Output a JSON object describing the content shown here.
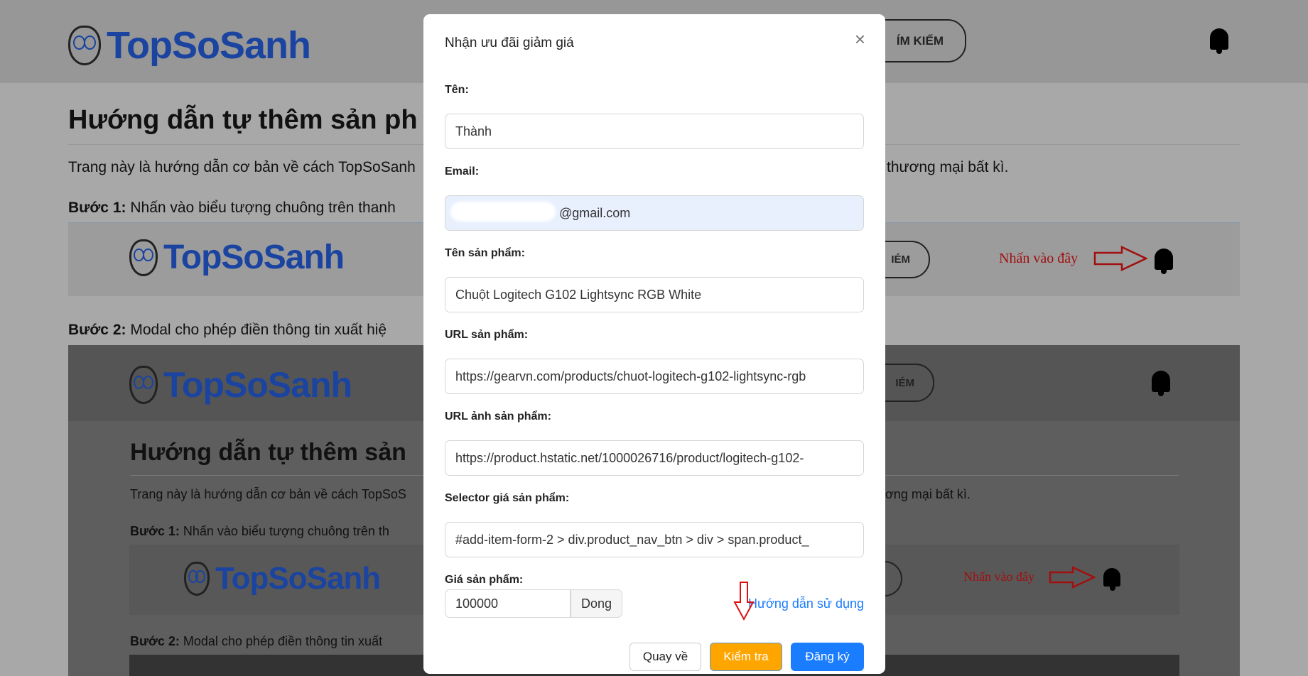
{
  "brand": {
    "name": "TopSoSanh",
    "search_label": "TÌM KIẾM",
    "search_label_partial": "ÍM KIẾM",
    "search_label_short": "IÉM"
  },
  "page": {
    "title": "Hướng dẫn tự thêm sản phẩm",
    "title_visible": "Hướng dẫn tự thêm sản ph",
    "intro_left": "Trang này là hướng dẫn cơ bản về cách TopSoSanh",
    "intro_right": "thương mại bất kì.",
    "step1_label": "Bước 1:",
    "step1_text": "Nhấn vào biểu tượng chuông trên thanh",
    "step2_label": "Bước 2:",
    "step2_text": "Modal cho phép điền thông tin xuất hiệ",
    "click_here": "Nhấn vào đây",
    "inner": {
      "title": "Hướng dẫn tự thêm sản",
      "intro_left": "Trang này là hướng dẫn cơ bản về cách TopSoS",
      "intro_right": "ơng mại bất kì.",
      "step1_text": "Nhấn vào biểu tượng chuông trên th",
      "step2_text": "Modal cho phép điền thông tin xuất"
    }
  },
  "modal": {
    "title": "Nhận ưu đãi giảm giá",
    "close": "×",
    "fields": [
      {
        "label": "Tên:",
        "value": "Thành"
      },
      {
        "label": "Email:",
        "value": "@gmail.com"
      },
      {
        "label": "Tên sản phẩm:",
        "value": "Chuột Logitech G102 Lightsync RGB White"
      },
      {
        "label": "URL sản phẩm:",
        "value": "https://gearvn.com/products/chuot-logitech-g102-lightsync-rgb"
      },
      {
        "label": "URL ảnh sản phẩm:",
        "value": "https://product.hstatic.net/1000026716/product/logitech-g102-"
      },
      {
        "label": "Selector giá sản phẩm:",
        "value": "#add-item-form-2 > div.product_nav_btn > div > span.product_"
      }
    ],
    "price_label": "Giá sản phẩm:",
    "price_value": "100000",
    "currency": "Dong",
    "help_link": "Hướng dẫn sử dụng",
    "back_label": "Quay về",
    "check_label": "Kiểm tra",
    "register_label": "Đăng ký",
    "colors": {
      "check": "#ffa500",
      "register": "#1a7cff",
      "link": "#1a7cff"
    }
  }
}
